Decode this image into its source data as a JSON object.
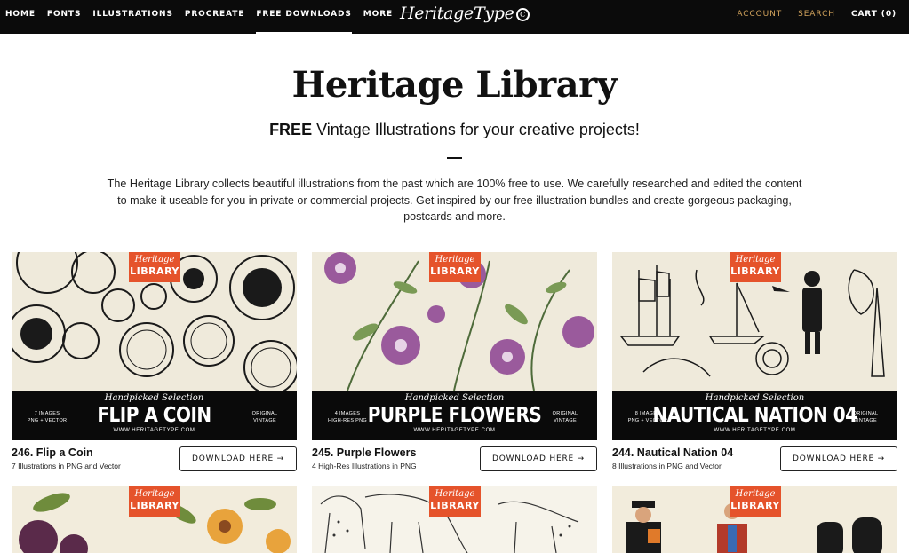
{
  "nav": {
    "left": [
      "HOME",
      "FONTS",
      "ILLUSTRATIONS",
      "PROCREATE",
      "FREE DOWNLOADS",
      "MORE"
    ],
    "logo": "HeritageType",
    "logo_mark": "C",
    "account": "ACCOUNT",
    "search": "SEARCH",
    "cart": "CART (0)"
  },
  "hero": {
    "title": "Heritage Library",
    "subtitle_bold": "FREE",
    "subtitle_rest": " Vintage Illustrations for your creative projects!",
    "intro": "The Heritage Library collects beautiful illustrations from the past which are 100% free to use. We carefully researched and edited the content to make it useable for you in private or commercial projects. Get inspired by our free illustration bundles and create gorgeous packaging, postcards and more."
  },
  "badge": {
    "line1": "Heritage",
    "line2": "LIBRARY"
  },
  "band_common": {
    "handpicked": "Handpicked Selection",
    "url": "WWW.HERITAGETYPE.COM",
    "right": "ORIGINAL\nVINTAGE"
  },
  "cards": [
    {
      "band_title": "FLIP A COIN",
      "band_left": "7 IMAGES\nPNG + VECTOR",
      "caption": "246. Flip a Coin",
      "desc": "7 Illustrations in PNG and Vector",
      "button": "DOWNLOAD HERE →"
    },
    {
      "band_title": "PURPLE FLOWERS",
      "band_left": "4 IMAGES\nHIGH-RES PNG",
      "caption": "245. Purple Flowers",
      "desc": "4 High-Res Illustrations in PNG",
      "button": "DOWNLOAD HERE →"
    },
    {
      "band_title": "NAUTICAL NATION 04",
      "band_left": "8 IMAGES\nPNG + VECTOR",
      "caption": "244. Nautical Nation 04",
      "desc": "8 Illustrations in PNG and Vector",
      "button": "DOWNLOAD HERE →"
    }
  ],
  "colors": {
    "nav_bg": "#0b0b0b",
    "accent_gold": "#d2a35c",
    "badge_orange": "#e5532b",
    "card_bg": "#efeadb"
  }
}
